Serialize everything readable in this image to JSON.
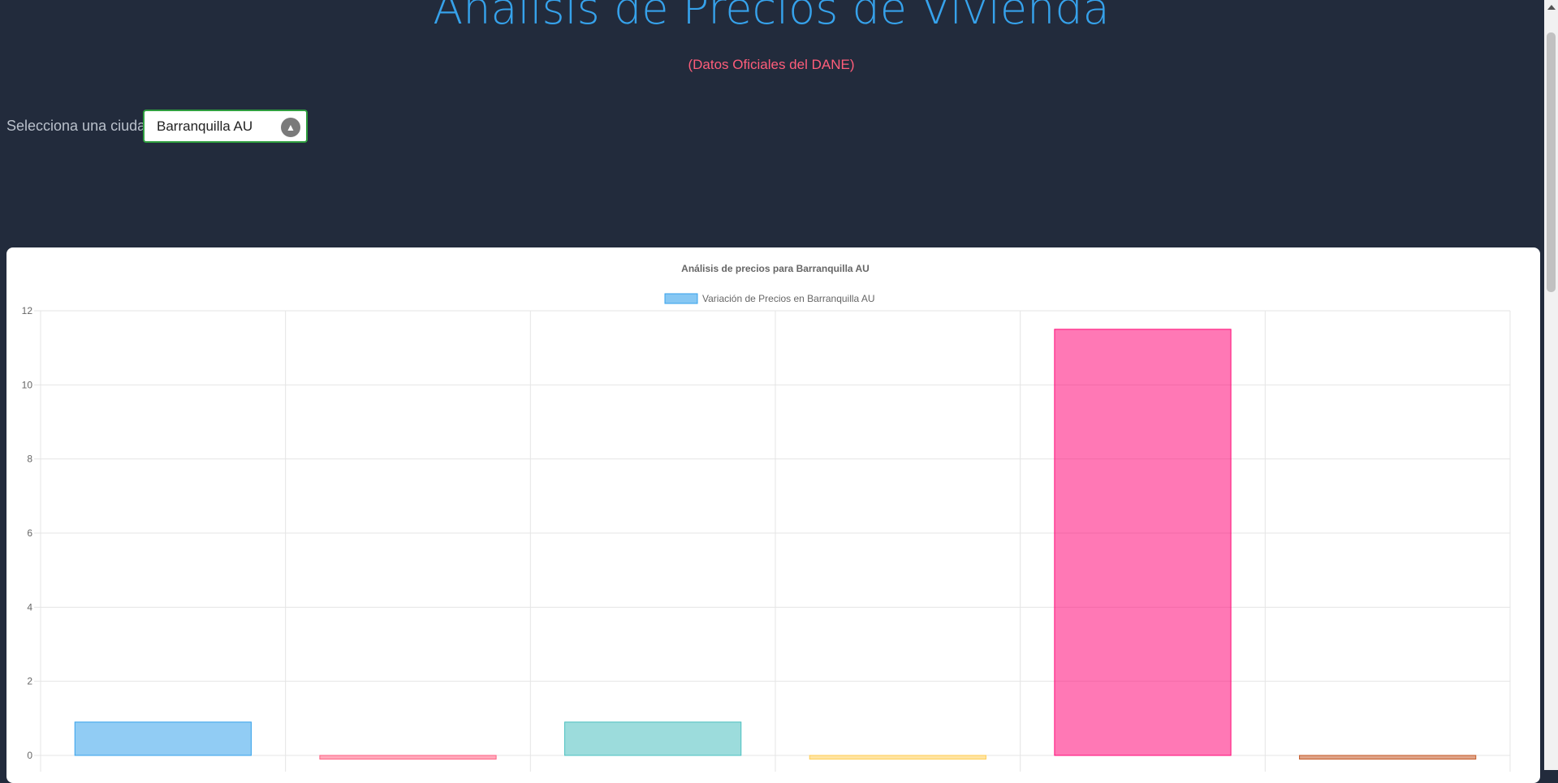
{
  "header": {
    "title": "Análisis de Precios de Vivienda",
    "subtitle": "(Datos Oficiales del DANE)"
  },
  "city_selector": {
    "label": "Selecciona una ciudad:",
    "selected": "Barranquilla AU",
    "icon": "chevron-up-icon"
  },
  "chart_data": {
    "type": "bar",
    "title": "Análisis de precios para Barranquilla AU",
    "legend": "top",
    "series": [
      {
        "name": "Variación de Precios en Barranquilla AU",
        "values": [
          0.9,
          -0.1,
          0.9,
          -0.1,
          11.5,
          -0.1
        ],
        "colors": [
          "#36a2eb",
          "#ff6384",
          "#4bc0c0",
          "#ffce56",
          "#ff0a78",
          "#c45a28"
        ]
      }
    ],
    "categories": [
      "",
      "",
      "",
      "",
      "",
      ""
    ],
    "yticks": [
      "0",
      "2",
      "4",
      "6",
      "8",
      "10",
      "12"
    ],
    "ylim": [
      0,
      12
    ],
    "grid": true
  }
}
